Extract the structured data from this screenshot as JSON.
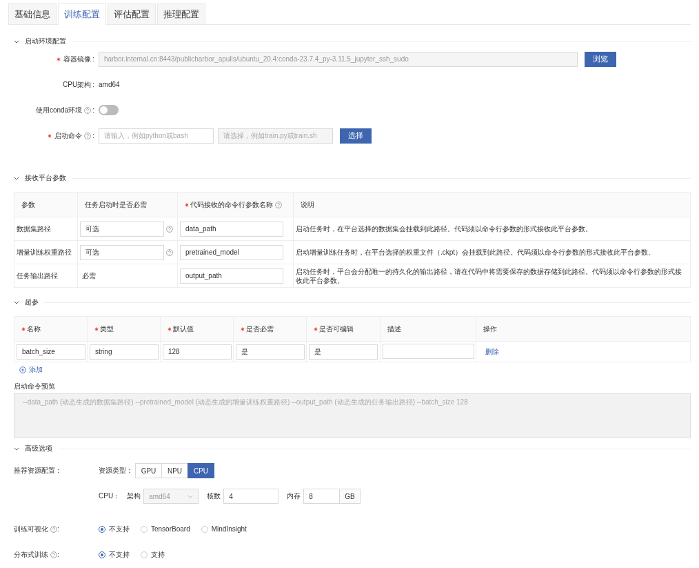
{
  "tabs": [
    {
      "label": "基础信息",
      "selected": false
    },
    {
      "label": "训练配置",
      "selected": true
    },
    {
      "label": "评估配置",
      "selected": false
    },
    {
      "label": "推理配置",
      "selected": false
    }
  ],
  "startup": {
    "title": "启动环境配置",
    "expanded": true,
    "image": {
      "label": "容器镜像",
      "required": true,
      "help": false,
      "colon": ":",
      "value": "harbor.internal.cn:8443/publicharbor_apulis/ubuntu_20.4:conda-23.7.4_py-3.11.5_jupyter_ssh_sudo",
      "button": "浏览"
    },
    "cpu_arch": {
      "label": "CPU架构",
      "required": false,
      "help": false,
      "colon": ":",
      "value": "amd64"
    },
    "conda": {
      "label": "使用conda环境",
      "required": false,
      "help": true,
      "colon": ":",
      "on": false
    },
    "command": {
      "label": "启动命令",
      "required": true,
      "help": true,
      "colon": ":",
      "placeholder": "请输入，例如python或bash",
      "file_placeholder": "请选择，例如train.py或train.sh",
      "button": "选择"
    }
  },
  "platform_params": {
    "title": "接收平台参数",
    "expanded": true,
    "columns": [
      {
        "label": "参数",
        "required": false,
        "help": false
      },
      {
        "label": "任务启动时是否必需",
        "required": false,
        "help": false
      },
      {
        "label": "代码接收的命令行参数名称",
        "required": true,
        "help": true
      },
      {
        "label": "说明",
        "required": false,
        "help": false
      }
    ],
    "rows": [
      {
        "param": "数据集路径",
        "kind": "select",
        "necessity": "可选",
        "arg": "data_path",
        "description": "启动任务时，在平台选择的数据集会挂载到此路径。代码须以命令行参数的形式接收此平台参数。"
      },
      {
        "param": "增量训练权重路径",
        "kind": "select",
        "necessity": "可选",
        "arg": "pretrained_model",
        "description": "启动增量训练任务时，在平台选择的权重文件（.ckpt）会挂载到此路径。代码须以命令行参数的形式接收此平台参数。"
      },
      {
        "param": "任务输出路径",
        "kind": "text",
        "necessity": "必需",
        "arg": "output_path",
        "description": "启动任务时，平台会分配唯一的持久化的输出路径，请在代码中将需要保存的数据存储到此路径。代码须以命令行参数的形式接收此平台参数。"
      }
    ]
  },
  "hyperparams": {
    "title": "超参",
    "expanded": true,
    "columns": [
      {
        "label": "名称",
        "required": true
      },
      {
        "label": "类型",
        "required": true
      },
      {
        "label": "默认值",
        "required": true
      },
      {
        "label": "是否必需",
        "required": true
      },
      {
        "label": "是否可编辑",
        "required": true
      },
      {
        "label": "描述",
        "required": false
      },
      {
        "label": "操作",
        "required": false
      }
    ],
    "rows": [
      {
        "name": "batch_size",
        "type": "string",
        "default": "128",
        "required": "是",
        "editable": "是",
        "action": "删除"
      }
    ],
    "add": "添加"
  },
  "preview": {
    "label": "启动命令预览",
    "text": "--data_path (动态生成的数据集路径) --pretrained_model (动态生成的增量训练权重路径) --output_path (动态生成的任务输出路径) --batch_size 128"
  },
  "advanced": {
    "title": "高级选项",
    "expanded": true,
    "resource": {
      "label": "推荐资源配置：",
      "type_label": "资源类型：",
      "types": [
        {
          "label": "GPU",
          "selected": false
        },
        {
          "label": "NPU",
          "selected": false
        },
        {
          "label": "CPU",
          "selected": true
        }
      ],
      "cpu_label": "CPU：",
      "arch_label": "架构",
      "arch": "amd64",
      "cores_label": "核数",
      "cores": "4",
      "memory_label": "内存",
      "memory": "8",
      "memory_unit": "GB"
    },
    "visualization": {
      "label": "训练可视化",
      "colon": ":",
      "options": [
        {
          "label": "不支持",
          "selected": true
        },
        {
          "label": "TensorBoard",
          "selected": false
        },
        {
          "label": "MindInsight",
          "selected": false
        }
      ]
    },
    "distributed": {
      "label": "分布式训练",
      "colon": ":",
      "options": [
        {
          "label": "不支持",
          "selected": true
        },
        {
          "label": "支持",
          "selected": false
        }
      ]
    }
  }
}
